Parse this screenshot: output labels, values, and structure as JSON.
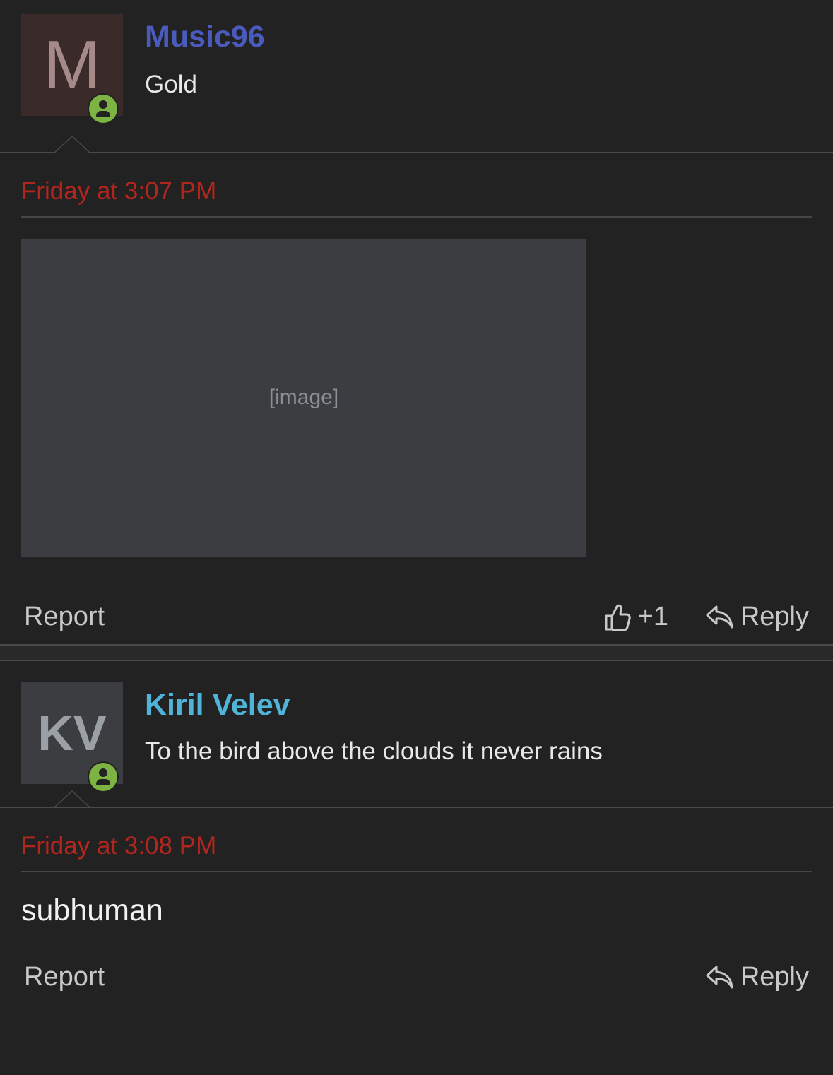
{
  "posts": [
    {
      "author": "Music96",
      "author_color": "#4a5bbd",
      "avatar_letter": "M",
      "user_title": "Gold",
      "timestamp": "Friday at 3:07 PM",
      "image_label": "[image]",
      "report_label": "Report",
      "like_count": "+1",
      "reply_label": "Reply"
    },
    {
      "author": "Kiril Velev",
      "author_color": "#4fb4d8",
      "avatar_placeholder": "KV",
      "user_title": "To the bird above the clouds it never rains",
      "timestamp": "Friday at 3:08 PM",
      "text": "subhuman",
      "report_label": "Report",
      "reply_label": "Reply"
    }
  ]
}
